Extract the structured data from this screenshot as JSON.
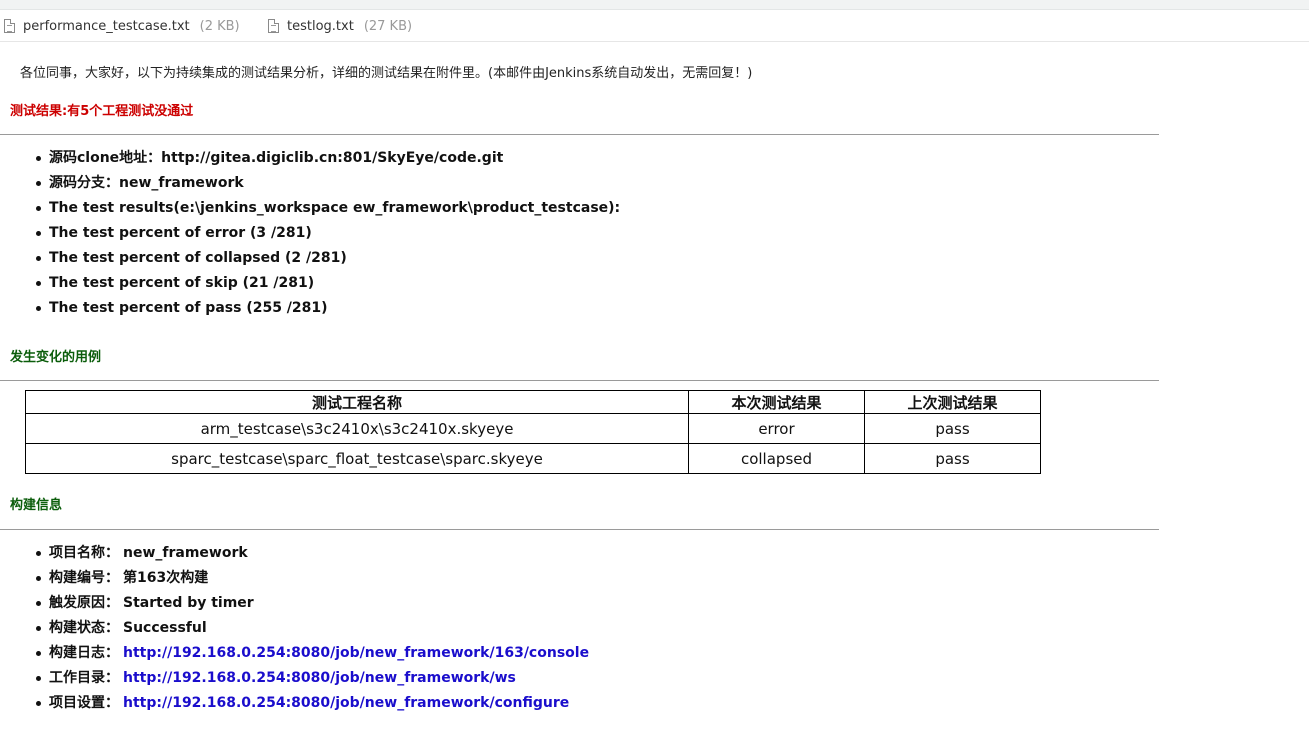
{
  "attachments": [
    {
      "name": "performance_testcase.txt",
      "size": "(2 KB)"
    },
    {
      "name": "testlog.txt",
      "size": "(27 KB)"
    }
  ],
  "intro": "各位同事，大家好，以下为持续集成的测试结果分析，详细的测试结果在附件里。(本邮件由Jenkins系统自动发出，无需回复！)",
  "result_heading": "测试结果:有5个工程测试没通过",
  "summary": [
    "源码clone地址：http://gitea.digiclib.cn:801/SkyEye/code.git",
    "源码分支：new_framework",
    "The test results(e:\\jenkins_workspace ew_framework\\product_testcase):",
    "The test percent of error (3 /281)",
    "The test percent of collapsed (2 /281)",
    "The test percent of skip (21 /281)",
    "The test percent of pass (255 /281)"
  ],
  "changes_heading": "发生变化的用例",
  "changes_table": {
    "headers": [
      "测试工程名称",
      "本次测试结果",
      "上次测试结果"
    ],
    "rows": [
      [
        "arm_testcase\\s3c2410x\\s3c2410x.skyeye",
        "error",
        "pass"
      ],
      [
        "sparc_testcase\\sparc_float_testcase\\sparc.skyeye",
        "collapsed",
        "pass"
      ]
    ]
  },
  "build_heading": "构建信息",
  "build_info": [
    {
      "label": "项目名称：",
      "value": "new_framework"
    },
    {
      "label": "构建编号：",
      "value": "第163次构建"
    },
    {
      "label": "触发原因：",
      "value": "Started by timer"
    },
    {
      "label": "构建状态：",
      "value": "Successful"
    },
    {
      "label": "构建日志：",
      "value": "http://192.168.0.254:8080/job/new_framework/163/console"
    },
    {
      "label": "工作目录：",
      "value": "http://192.168.0.254:8080/job/new_framework/ws"
    },
    {
      "label": "项目设置：",
      "value": "http://192.168.0.254:8080/job/new_framework/configure"
    }
  ],
  "colors": {
    "result_heading": "#cc0000",
    "section_heading": "#0b5d0b",
    "link": "#1a0dcc"
  }
}
